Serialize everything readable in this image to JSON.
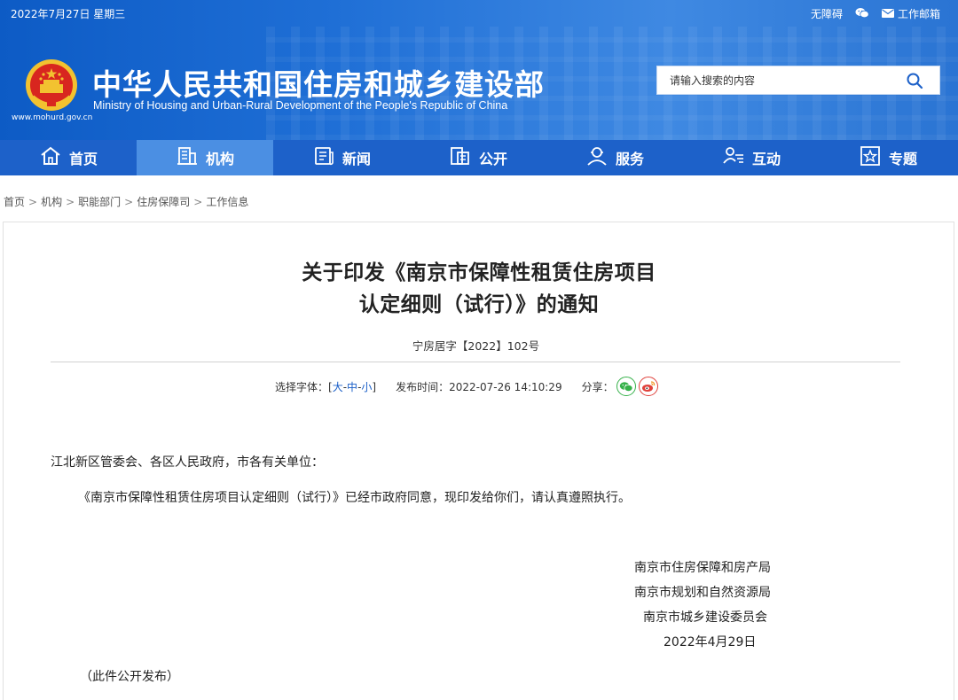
{
  "header": {
    "date": "2022年7月27日 星期三",
    "accessibility": "无障碍",
    "mailbox": "工作邮箱",
    "site_url": "www.mohurd.gov.cn",
    "title": "中华人民共和国住房和城乡建设部",
    "subtitle": "Ministry of Housing and Urban-Rural Development of the People's Republic of China",
    "search_placeholder": "请输入搜索的内容"
  },
  "nav": {
    "items": [
      {
        "label": "首页",
        "icon": "home-icon"
      },
      {
        "label": "机构",
        "icon": "building-icon",
        "active": true
      },
      {
        "label": "新闻",
        "icon": "news-icon"
      },
      {
        "label": "公开",
        "icon": "document-icon"
      },
      {
        "label": "服务",
        "icon": "service-icon"
      },
      {
        "label": "互动",
        "icon": "interaction-icon"
      },
      {
        "label": "专题",
        "icon": "star-frame-icon"
      }
    ]
  },
  "breadcrumb": {
    "items": [
      "首页",
      "机构",
      "职能部门",
      "住房保障司",
      "工作信息"
    ],
    "separator": ">"
  },
  "article": {
    "title_line1": "关于印发《南京市保障性租赁住房项目",
    "title_line2": "认定细则（试行）》的通知",
    "doc_number": "宁房居字【2022】102号",
    "font_size_label": "选择字体：[",
    "font_size_close": "]",
    "font_large": "大",
    "font_medium": "中",
    "font_small": "小",
    "font_dash": "-",
    "publish_label": "发布时间：",
    "publish_time": "2022-07-26 14:10:29",
    "share_label": "分享：",
    "salutation": "江北新区管委会、各区人民政府，市各有关单位：",
    "paragraph": "《南京市保障性租赁住房项目认定细则（试行）》已经市政府同意，现印发给你们，请认真遵照执行。",
    "signatories": [
      "南京市住房保障和房产局",
      "南京市规划和自然资源局",
      "南京市城乡建设委员会"
    ],
    "sign_date": "2022年4月29日",
    "note": "（此件公开发布）"
  },
  "colors": {
    "header_blue": "#1f6fd6",
    "nav_blue": "#1d61c9",
    "nav_active": "#4b8fe3",
    "link_blue": "#1a5fc8",
    "wechat_green": "#36b14a",
    "weibo_red": "#e0413b"
  }
}
